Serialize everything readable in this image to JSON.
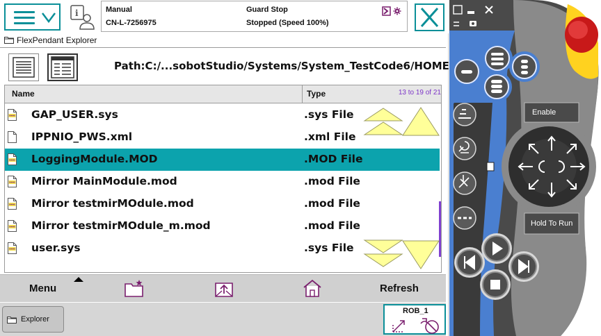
{
  "status": {
    "mode": "Manual",
    "controller": "CN-L-7256975",
    "state": "Guard Stop",
    "run_state": "Stopped (Speed 100%)"
  },
  "app": {
    "title": "FlexPendant Explorer",
    "path": "Path:C:/...sobotStudio/Systems/System_TestCode6/HOME/"
  },
  "table": {
    "col_name": "Name",
    "col_type": "Type",
    "count": "13 to 19 of 21",
    "selected_index": 2,
    "rows": [
      {
        "name": "GAP_USER.sys",
        "type": ".sys File",
        "icon": "sys-file-icon"
      },
      {
        "name": "IPPNIO_PWS.xml",
        "type": ".xml File",
        "icon": "file-icon"
      },
      {
        "name": "LoggingModule.MOD",
        "type": ".MOD File",
        "icon": "mod-file-icon"
      },
      {
        "name": "Mirror MainModule.mod",
        "type": ".mod File",
        "icon": "mod-file-icon"
      },
      {
        "name": "Mirror testmirMOdule.mod",
        "type": ".mod File",
        "icon": "mod-file-icon"
      },
      {
        "name": "Mirror testmirMOdule_m.mod",
        "type": ".mod File",
        "icon": "mod-file-icon"
      },
      {
        "name": "user.sys",
        "type": ".sys File",
        "icon": "sys-file-icon"
      }
    ]
  },
  "bottom": {
    "menu": "Menu",
    "refresh": "Refresh"
  },
  "taskbar": {
    "explorer": "Explorer",
    "quickset": "ROB_1"
  },
  "device": {
    "enable": "Enable",
    "hold_to_run": "Hold To Run"
  },
  "colors": {
    "accent": "#0a8f98",
    "selected_row": "#0ca3ad",
    "scroll_arrow": "#ffff99",
    "count_text": "#7d35c8",
    "device_body": "#4d4d4d",
    "device_blue": "#4a7fd0",
    "estop_red": "#d21f1f",
    "estop_yellow": "#ffd21f"
  }
}
